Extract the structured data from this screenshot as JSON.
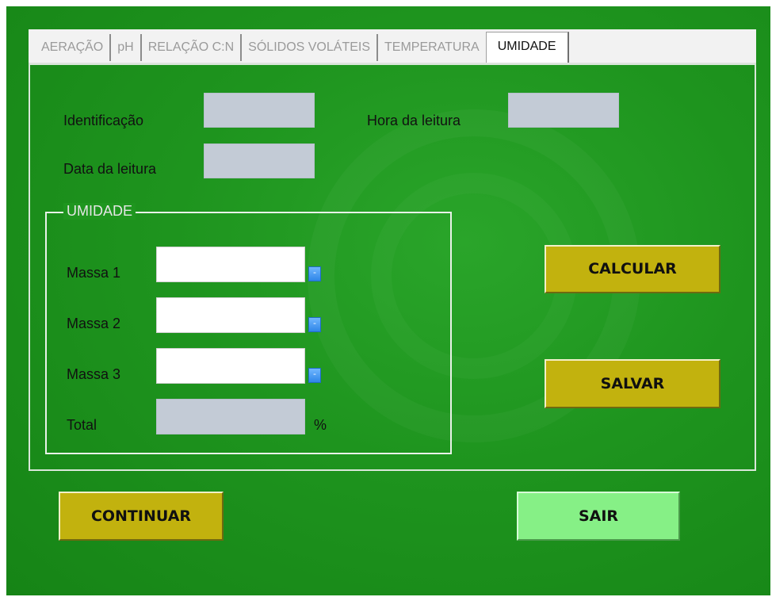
{
  "tabs": [
    {
      "label": "AERAÇÃO",
      "active": false
    },
    {
      "label": "pH",
      "active": false
    },
    {
      "label": "RELAÇÃO C:N",
      "active": false
    },
    {
      "label": "SÓLIDOS VOLÁTEIS",
      "active": false
    },
    {
      "label": "TEMPERATURA",
      "active": false
    },
    {
      "label": "UMIDADE",
      "active": true
    }
  ],
  "form": {
    "identificacao_label": "Identificação",
    "identificacao_value": "",
    "hora_label": "Hora da leitura",
    "hora_value": "",
    "data_label": "Data da leitura",
    "data_value": ""
  },
  "umidade": {
    "title": "UMIDADE",
    "massa1_label": "Massa 1",
    "massa1_value": "",
    "massa2_label": "Massa 2",
    "massa2_value": "",
    "massa3_label": "Massa 3",
    "massa3_value": "",
    "spin_glyph": "-",
    "total_label": "Total",
    "total_value": "",
    "total_unit": "%"
  },
  "buttons": {
    "calcular": "CALCULAR",
    "salvar": "SALVAR",
    "continuar": "CONTINUAR",
    "sair": "SAIR"
  },
  "colors": {
    "background_green": "#1e941e",
    "button_olive": "#c2b20e",
    "button_light_green": "#86f086",
    "readonly_field": "#c3cbd6"
  }
}
